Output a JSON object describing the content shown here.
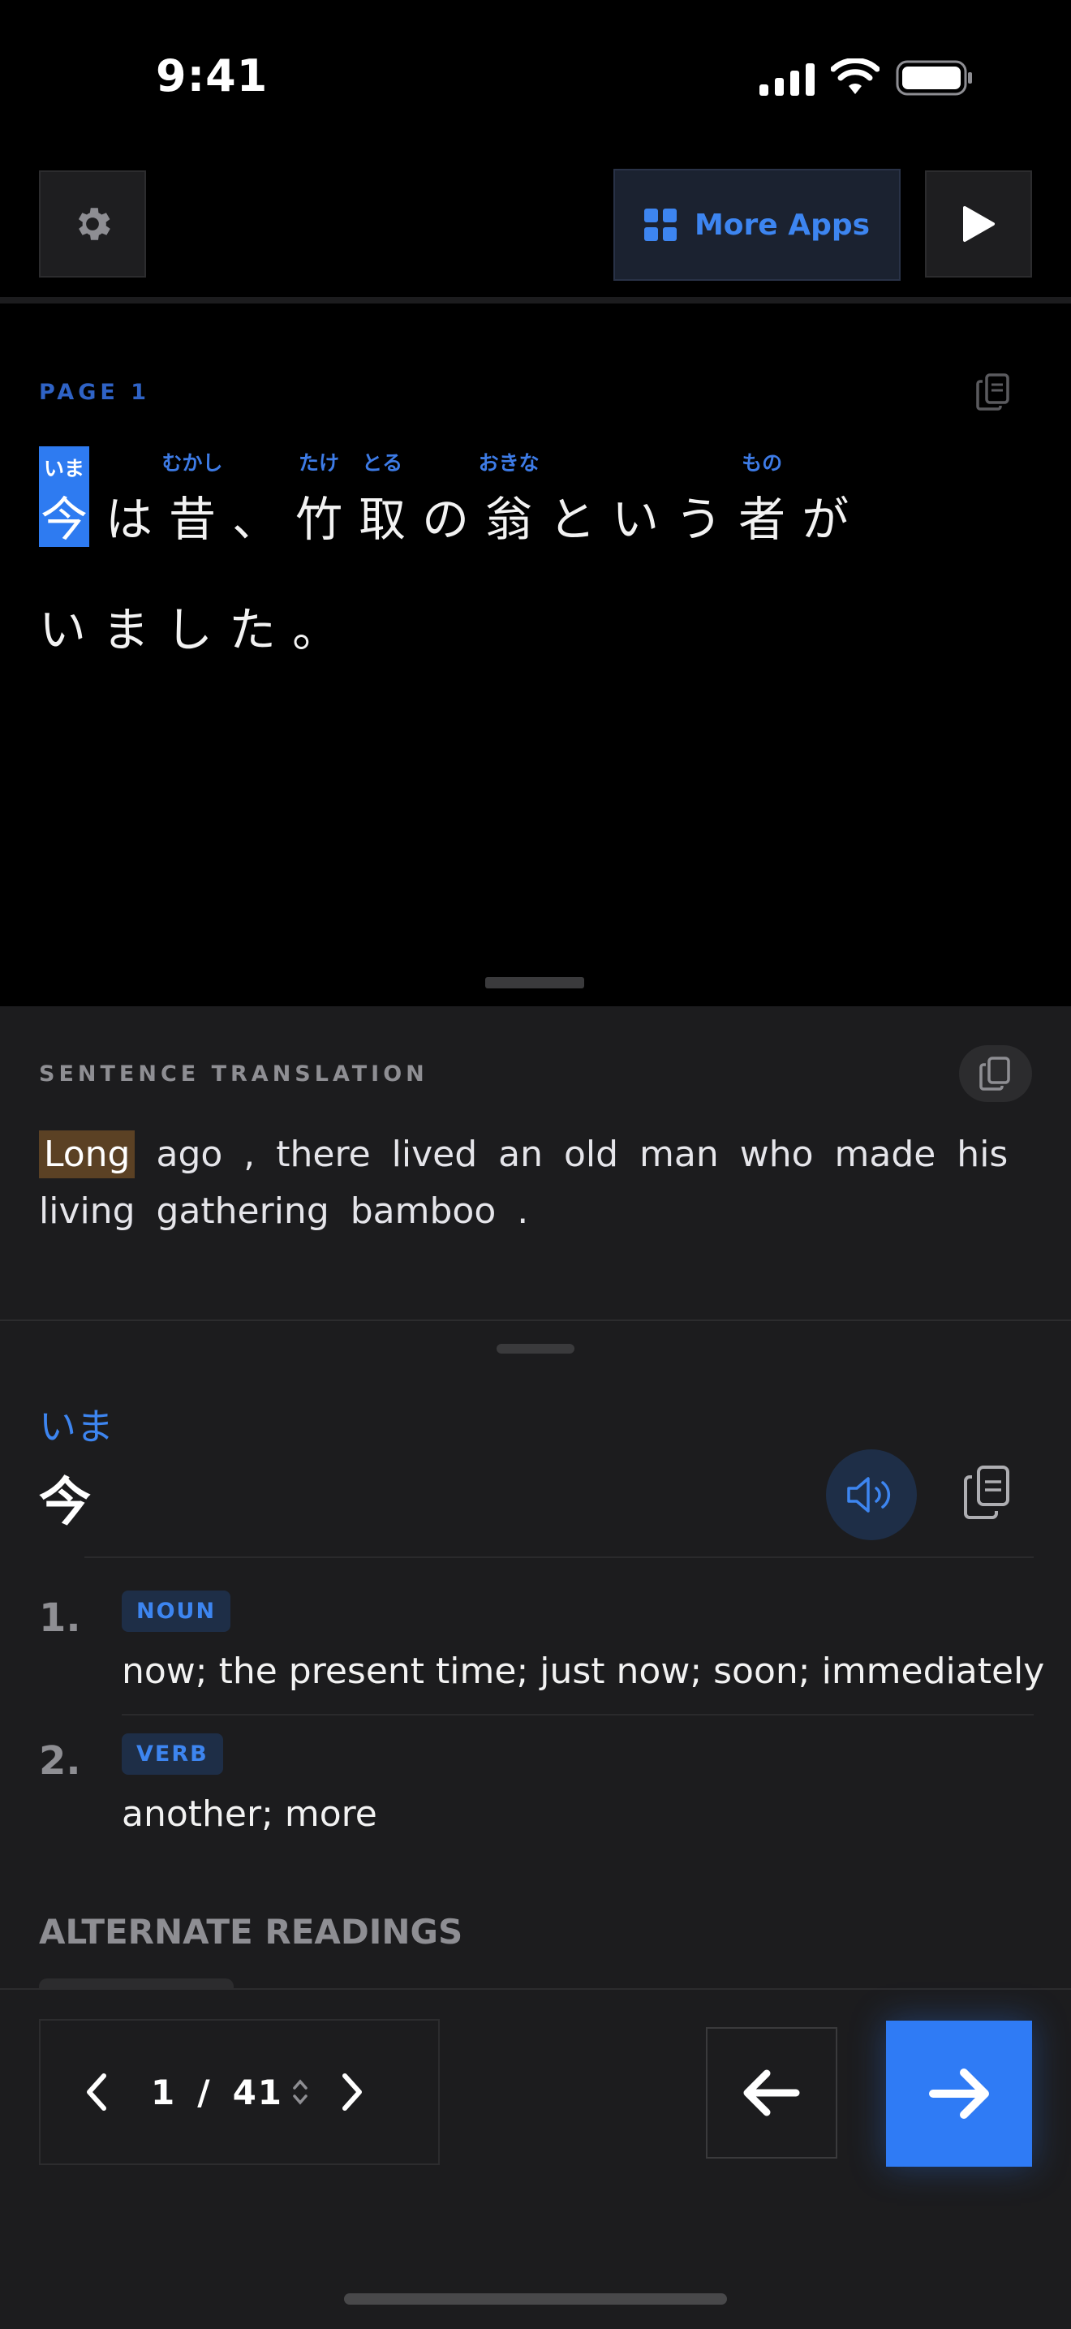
{
  "status_bar": {
    "time": "9:41"
  },
  "toolbar": {
    "more_apps_label": "More Apps"
  },
  "reader": {
    "page_label": "PAGE 1",
    "line1": [
      {
        "text": "今",
        "ruby": "いま",
        "selected": true
      },
      {
        "text": "は",
        "ruby": ""
      },
      {
        "text": "昔",
        "ruby": "むかし"
      },
      {
        "text": "、",
        "ruby": ""
      },
      {
        "text": "竹",
        "ruby": "たけ"
      },
      {
        "text": "取",
        "ruby": "とる"
      },
      {
        "text": "の",
        "ruby": ""
      },
      {
        "text": "翁",
        "ruby": "おきな"
      },
      {
        "text": "と",
        "ruby": ""
      },
      {
        "text": "い",
        "ruby": ""
      },
      {
        "text": "う",
        "ruby": ""
      },
      {
        "text": "者",
        "ruby": "もの"
      },
      {
        "text": "が",
        "ruby": ""
      }
    ],
    "line2": [
      "い",
      "ま",
      "し",
      "た",
      "。"
    ]
  },
  "translation": {
    "label": "SENTENCE TRANSLATION",
    "highlight": "Long",
    "rest": "ago , there lived an old man who made his living gathering bamboo ."
  },
  "dictionary": {
    "reading": "いま",
    "headword": "今",
    "senses": [
      {
        "number": "1.",
        "pos": "NOUN",
        "gloss": "now; the present time; just now; soon; immediately"
      },
      {
        "number": "2.",
        "pos": "VERB",
        "gloss": "another; more"
      }
    ],
    "alternate_label": "ALTERNATE READINGS"
  },
  "footer": {
    "current_page": "1",
    "separator": "/",
    "total_pages": "41"
  },
  "colors": {
    "accent": "#2f7bf5",
    "highlight": "#5b4124",
    "panel": "#1c1c1e"
  }
}
